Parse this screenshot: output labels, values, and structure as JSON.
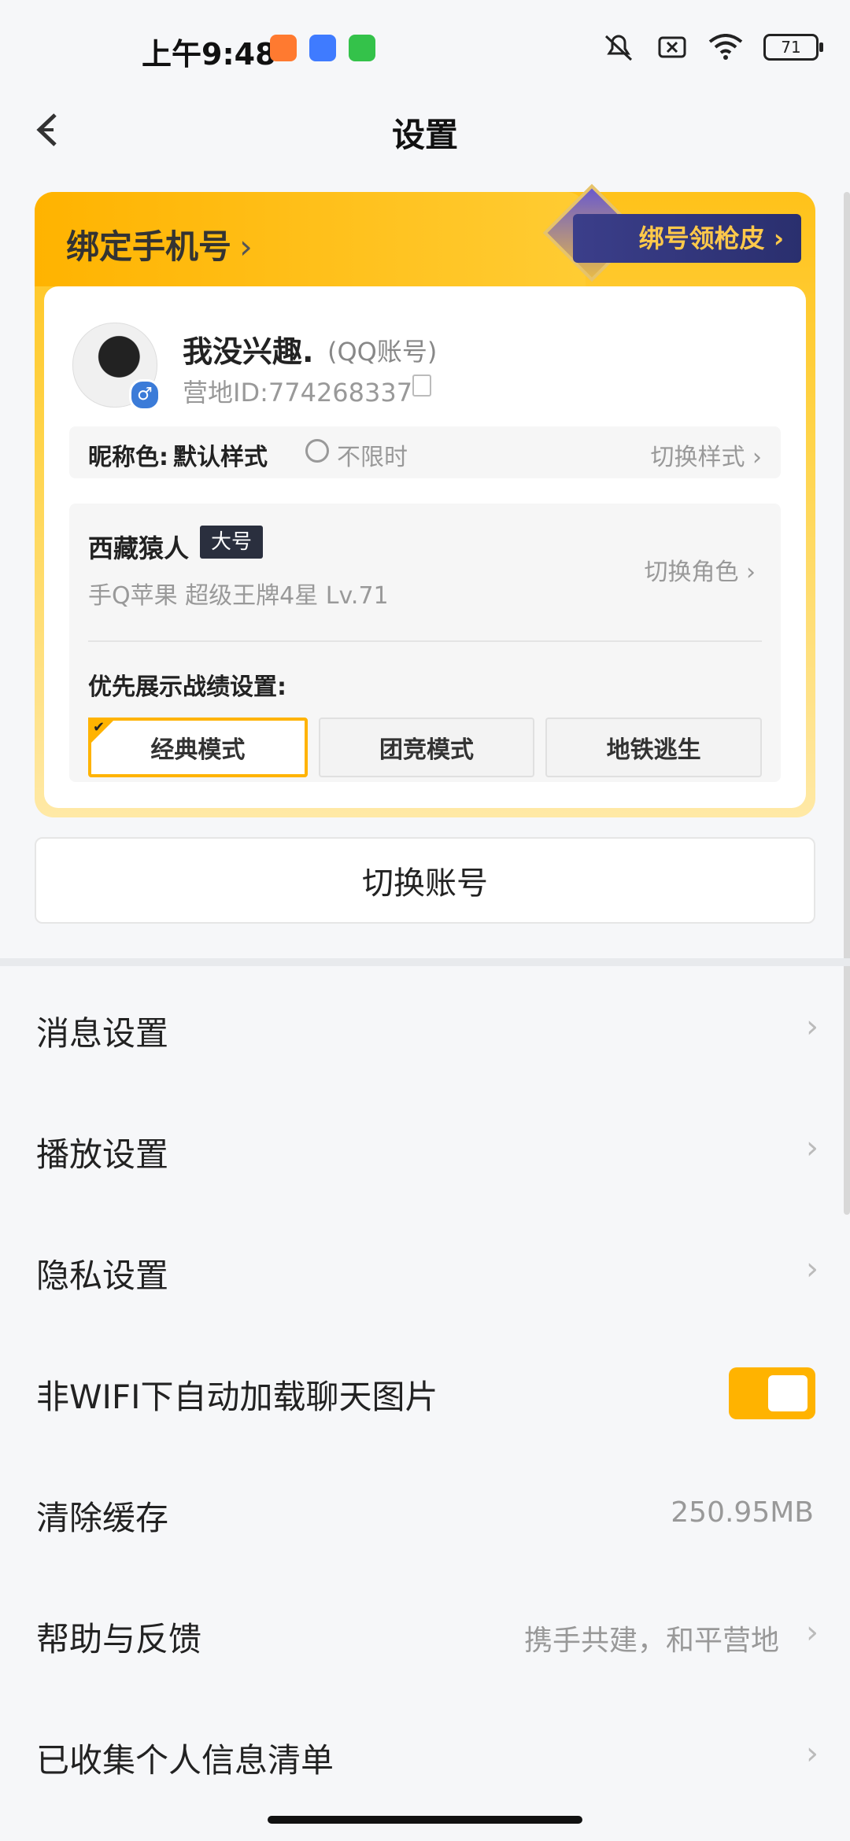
{
  "status_bar": {
    "time": "上午9:48",
    "battery": "71",
    "icons": [
      "app-red-icon",
      "app-blue-icon",
      "app-green-icon",
      "mute-icon",
      "no-sim-icon",
      "wifi-icon",
      "battery-icon"
    ]
  },
  "header": {
    "title": "设置"
  },
  "bind_card": {
    "title": "绑定手机号",
    "promo": "绑号领枪皮",
    "user": {
      "name": "我没兴趣.",
      "account_type": "(QQ账号)",
      "camp_id": "营地ID:774268337"
    },
    "nickname": {
      "label": "昵称色:",
      "value": "默认样式",
      "limit": "不限时",
      "switch_label": "切换样式"
    },
    "role": {
      "name": "西藏猿人",
      "badge": "大号",
      "info": "手Q苹果   超级王牌4星   Lv.71",
      "switch_label": "切换角色",
      "priority_label": "优先展示战绩设置:",
      "modes": [
        "经典模式",
        "团竞模式",
        "地铁逃生"
      ],
      "active_mode": "经典模式"
    }
  },
  "switch_account": "切换账号",
  "settings": [
    {
      "label": "消息设置"
    },
    {
      "label": "播放设置"
    },
    {
      "label": "隐私设置"
    },
    {
      "label": "非WIFI下自动加载聊天图片",
      "toggle": true
    },
    {
      "label": "清除缓存",
      "value": "250.95MB"
    },
    {
      "label": "帮助与反馈",
      "value": "携手共建，和平营地"
    },
    {
      "label": "已收集个人信息清单"
    }
  ],
  "colors": {
    "accent": "#ffb300",
    "background": "#f6f7f9"
  }
}
